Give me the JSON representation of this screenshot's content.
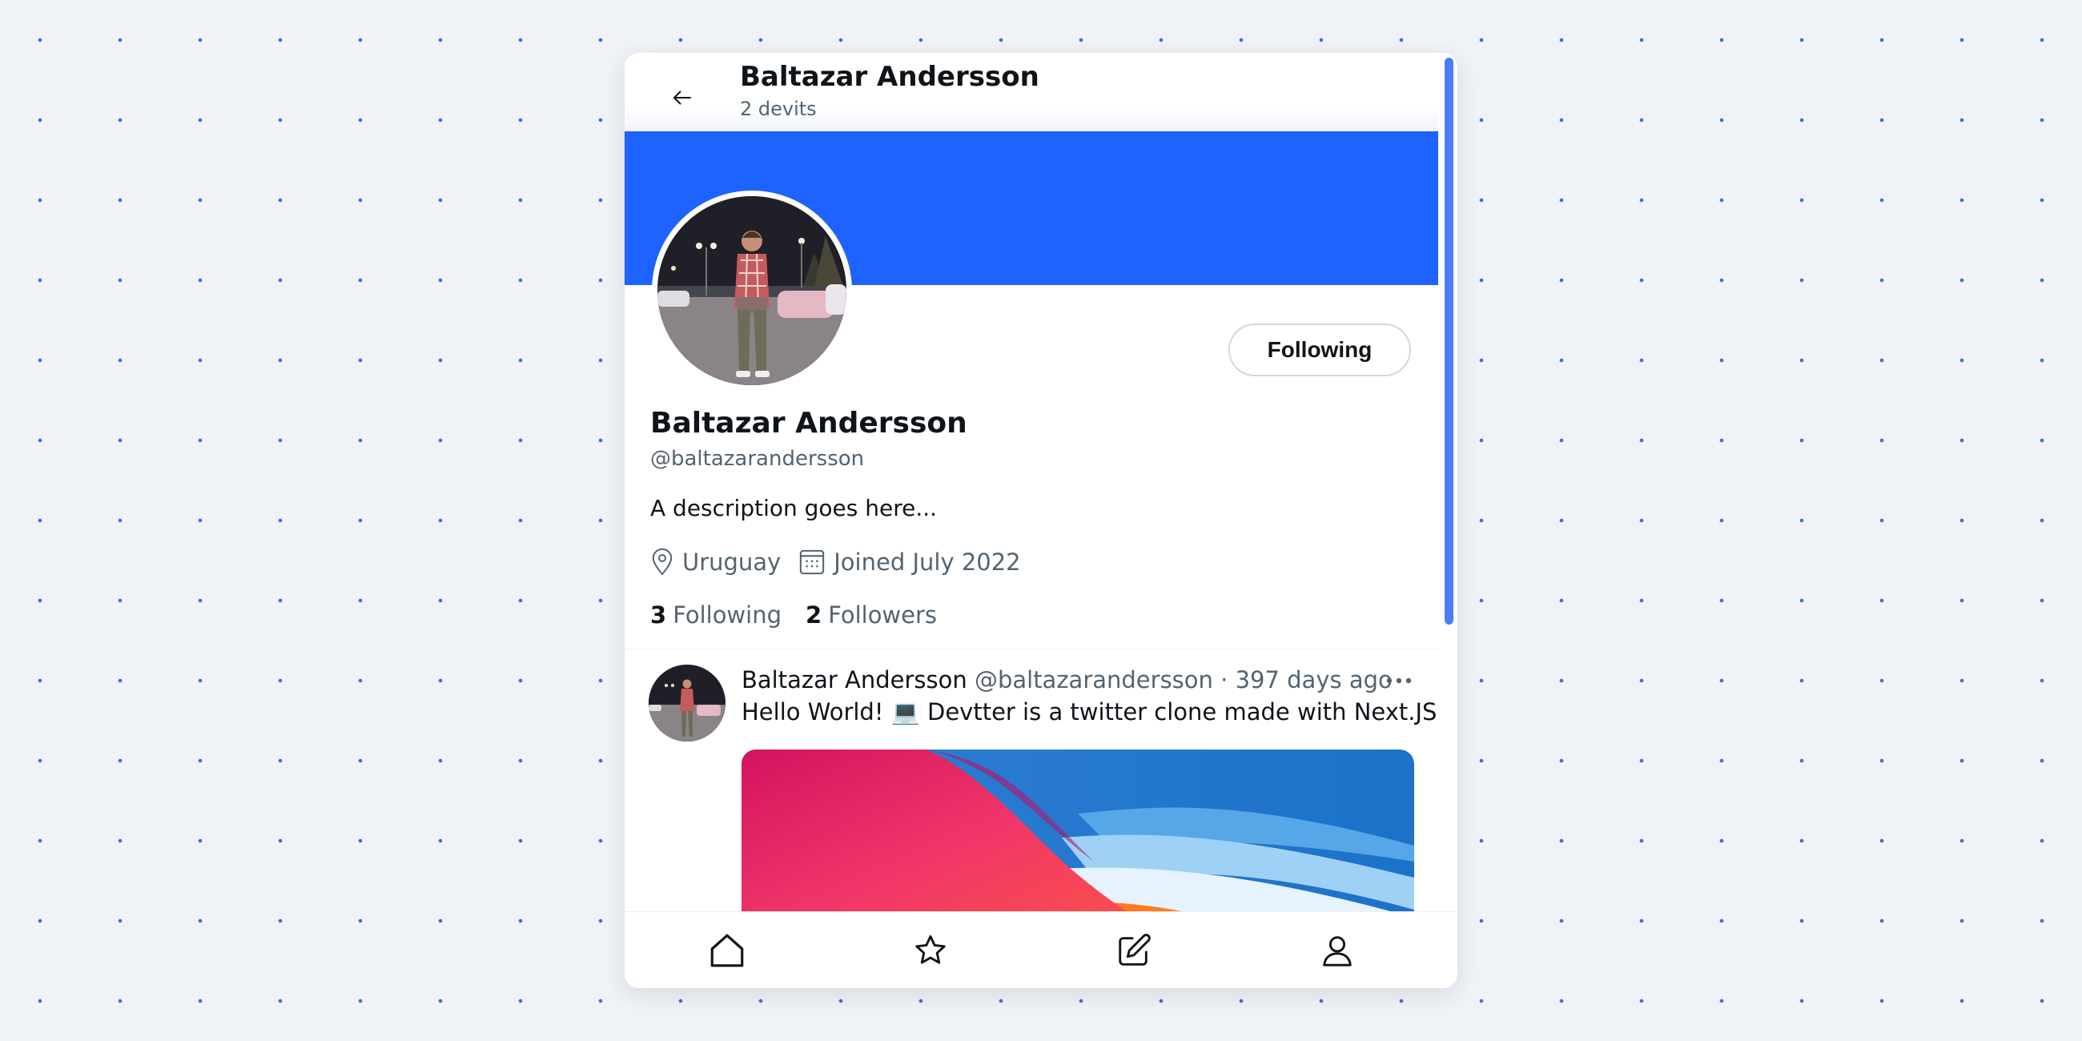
{
  "header": {
    "name": "Baltazar Andersson",
    "count": "2 devits"
  },
  "profile": {
    "name": "Baltazar Andersson",
    "handle": "@baltazarandersson",
    "bio": "A description goes here...",
    "location": "Uruguay",
    "joined": "Joined July 2022",
    "following_count": "3",
    "following_label": "Following",
    "followers_count": "2",
    "followers_label": "Followers",
    "follow_button_label": "Following"
  },
  "post": {
    "author": "Baltazar Andersson",
    "handle": "@baltazarandersson",
    "time": " · 397 days ago",
    "text": "Hello World! 💻 Devtter is a twitter clone made with Next.JS"
  },
  "nav": {
    "icons": [
      "home-icon",
      "star-icon",
      "compose-icon",
      "profile-icon"
    ]
  },
  "colors": {
    "accent": "#1e62ff",
    "scrollbar": "#4a7ff3",
    "background": "#eff2f6",
    "text": "#0f1419",
    "muted": "#536471"
  }
}
